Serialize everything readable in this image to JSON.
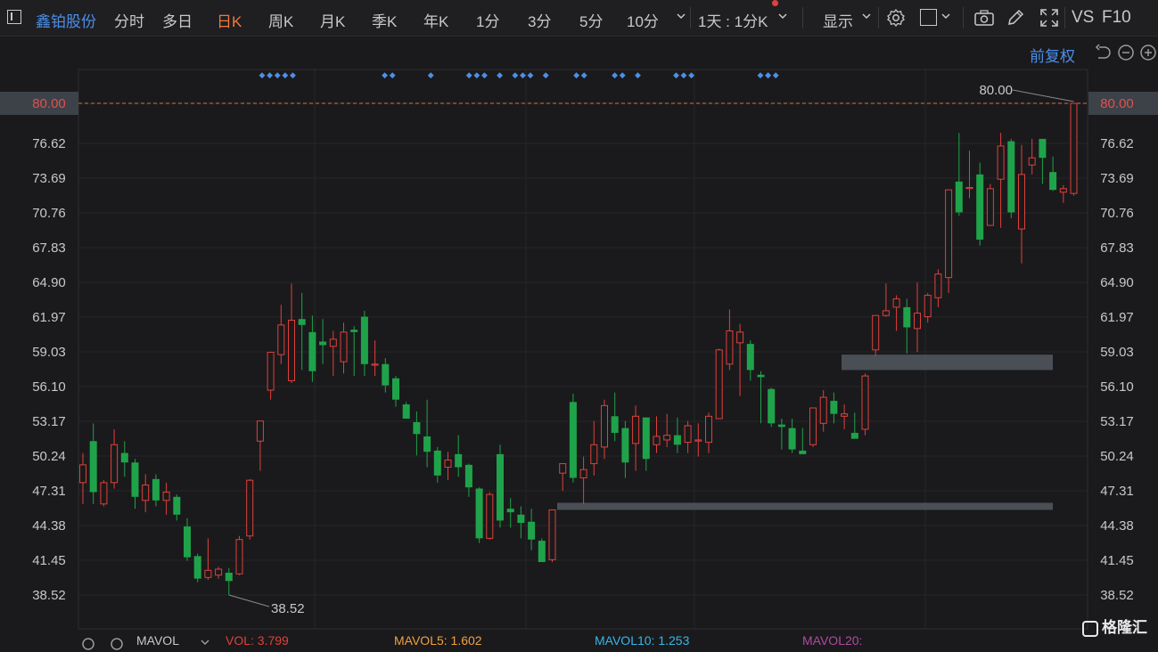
{
  "toolbar": {
    "stock_name": "鑫铂股份",
    "tabs": [
      "分时",
      "多日",
      "日K",
      "周K",
      "月K",
      "季K",
      "年K",
      "1分",
      "3分",
      "5分",
      "10分"
    ],
    "active_tab": "日K",
    "period_select": "1天 : 1分K",
    "display_label": "显示",
    "vs_label": "VS",
    "f10_label": "F10"
  },
  "subbar": {
    "adjust_label": "前复权"
  },
  "colors": {
    "up": "#e0403a",
    "down": "#1fa34a",
    "active": "#f07a3a",
    "marker": "#4c8fe8",
    "background": "#1a1a1c"
  },
  "axis": {
    "ticks": [
      "80.00",
      "76.62",
      "73.69",
      "70.76",
      "67.83",
      "64.90",
      "61.97",
      "59.03",
      "56.10",
      "53.17",
      "50.24",
      "47.31",
      "44.38",
      "41.45",
      "38.52"
    ],
    "current_price": "80.00",
    "high_label": "80.00",
    "low_label": "38.52"
  },
  "chart_data": {
    "type": "candlestick",
    "ylim": [
      37.0,
      81.5
    ],
    "last_price": 80.0,
    "period_high": 80.0,
    "period_low": 38.52,
    "candles": [
      {
        "o": 48.0,
        "h": 50.5,
        "l": 46.2,
        "c": 49.5
      },
      {
        "o": 51.5,
        "h": 53.0,
        "l": 46.2,
        "c": 47.2
      },
      {
        "o": 46.2,
        "h": 48.2,
        "l": 46.0,
        "c": 48.0
      },
      {
        "o": 48.0,
        "h": 52.5,
        "l": 47.5,
        "c": 51.2
      },
      {
        "o": 50.5,
        "h": 51.5,
        "l": 48.5,
        "c": 49.7
      },
      {
        "o": 49.7,
        "h": 50.0,
        "l": 45.8,
        "c": 46.8
      },
      {
        "o": 46.5,
        "h": 48.7,
        "l": 45.5,
        "c": 47.8
      },
      {
        "o": 48.3,
        "h": 48.7,
        "l": 46.0,
        "c": 46.5
      },
      {
        "o": 46.5,
        "h": 48.0,
        "l": 45.3,
        "c": 47.2
      },
      {
        "o": 46.8,
        "h": 47.0,
        "l": 44.8,
        "c": 45.3
      },
      {
        "o": 44.3,
        "h": 45.0,
        "l": 41.4,
        "c": 41.7
      },
      {
        "o": 41.8,
        "h": 42.0,
        "l": 39.6,
        "c": 39.9
      },
      {
        "o": 40.0,
        "h": 43.3,
        "l": 39.8,
        "c": 40.6
      },
      {
        "o": 40.2,
        "h": 40.9,
        "l": 39.9,
        "c": 40.7
      },
      {
        "o": 40.4,
        "h": 40.8,
        "l": 38.5,
        "c": 39.7
      },
      {
        "o": 40.3,
        "h": 43.5,
        "l": 40.2,
        "c": 43.2
      },
      {
        "o": 43.5,
        "h": 48.3,
        "l": 43.2,
        "c": 48.2
      },
      {
        "o": 51.5,
        "h": 53.2,
        "l": 49.0,
        "c": 53.2
      },
      {
        "o": 55.8,
        "h": 59.0,
        "l": 55.0,
        "c": 59.0
      },
      {
        "o": 58.8,
        "h": 63.0,
        "l": 58.0,
        "c": 61.3
      },
      {
        "o": 56.6,
        "h": 64.8,
        "l": 56.4,
        "c": 61.7
      },
      {
        "o": 61.8,
        "h": 64.0,
        "l": 57.5,
        "c": 61.3
      },
      {
        "o": 60.7,
        "h": 62.1,
        "l": 56.5,
        "c": 57.4
      },
      {
        "o": 59.9,
        "h": 61.8,
        "l": 58.0,
        "c": 59.6
      },
      {
        "o": 59.5,
        "h": 60.8,
        "l": 57.0,
        "c": 60.1
      },
      {
        "o": 58.2,
        "h": 61.5,
        "l": 57.2,
        "c": 60.7
      },
      {
        "o": 60.9,
        "h": 61.2,
        "l": 57.0,
        "c": 60.7
      },
      {
        "o": 62.0,
        "h": 62.5,
        "l": 57.0,
        "c": 58.0
      },
      {
        "o": 58.0,
        "h": 60.0,
        "l": 57.0,
        "c": 58.0
      },
      {
        "o": 58.0,
        "h": 58.5,
        "l": 55.6,
        "c": 56.2
      },
      {
        "o": 56.8,
        "h": 57.0,
        "l": 54.4,
        "c": 55.0
      },
      {
        "o": 54.6,
        "h": 54.8,
        "l": 53.4,
        "c": 53.4
      },
      {
        "o": 53.1,
        "h": 54.0,
        "l": 50.3,
        "c": 52.1
      },
      {
        "o": 51.9,
        "h": 55.0,
        "l": 49.3,
        "c": 50.6
      },
      {
        "o": 50.7,
        "h": 51.0,
        "l": 48.0,
        "c": 48.6
      },
      {
        "o": 49.3,
        "h": 50.6,
        "l": 48.2,
        "c": 49.9
      },
      {
        "o": 50.4,
        "h": 52.0,
        "l": 48.5,
        "c": 49.3
      },
      {
        "o": 49.5,
        "h": 49.6,
        "l": 46.8,
        "c": 47.6
      },
      {
        "o": 47.5,
        "h": 47.6,
        "l": 42.9,
        "c": 43.3
      },
      {
        "o": 43.3,
        "h": 47.2,
        "l": 43.2,
        "c": 47.0
      },
      {
        "o": 50.4,
        "h": 51.2,
        "l": 44.2,
        "c": 44.8
      },
      {
        "o": 45.8,
        "h": 46.7,
        "l": 44.2,
        "c": 45.5
      },
      {
        "o": 45.3,
        "h": 46.0,
        "l": 43.3,
        "c": 44.6
      },
      {
        "o": 44.7,
        "h": 45.8,
        "l": 42.3,
        "c": 43.2
      },
      {
        "o": 43.1,
        "h": 43.3,
        "l": 41.7,
        "c": 41.3
      },
      {
        "o": 41.5,
        "h": 45.7,
        "l": 41.3,
        "c": 45.7
      },
      {
        "o": 48.8,
        "h": 49.6,
        "l": 47.3,
        "c": 49.6
      },
      {
        "o": 54.8,
        "h": 55.5,
        "l": 48.0,
        "c": 48.4
      },
      {
        "o": 48.4,
        "h": 50.2,
        "l": 46.2,
        "c": 49.1
      },
      {
        "o": 49.6,
        "h": 53.2,
        "l": 48.6,
        "c": 51.2
      },
      {
        "o": 51.0,
        "h": 55.0,
        "l": 50.0,
        "c": 54.5
      },
      {
        "o": 53.6,
        "h": 55.6,
        "l": 51.5,
        "c": 52.2
      },
      {
        "o": 52.6,
        "h": 53.2,
        "l": 48.4,
        "c": 49.7
      },
      {
        "o": 51.3,
        "h": 54.5,
        "l": 49.0,
        "c": 53.6
      },
      {
        "o": 53.5,
        "h": 53.5,
        "l": 49.0,
        "c": 50.0
      },
      {
        "o": 51.2,
        "h": 53.6,
        "l": 50.5,
        "c": 51.9
      },
      {
        "o": 51.6,
        "h": 53.8,
        "l": 51.0,
        "c": 52.0
      },
      {
        "o": 52.0,
        "h": 53.5,
        "l": 50.5,
        "c": 51.2
      },
      {
        "o": 51.4,
        "h": 53.2,
        "l": 50.5,
        "c": 52.8
      },
      {
        "o": 51.6,
        "h": 53.0,
        "l": 50.2,
        "c": 51.6
      },
      {
        "o": 51.4,
        "h": 53.9,
        "l": 50.5,
        "c": 53.6
      },
      {
        "o": 53.4,
        "h": 59.3,
        "l": 53.4,
        "c": 59.2
      },
      {
        "o": 58.0,
        "h": 62.6,
        "l": 57.5,
        "c": 60.8
      },
      {
        "o": 59.8,
        "h": 61.4,
        "l": 55.3,
        "c": 60.7
      },
      {
        "o": 59.7,
        "h": 60.0,
        "l": 56.6,
        "c": 57.5
      },
      {
        "o": 57.1,
        "h": 57.4,
        "l": 53.0,
        "c": 56.9
      },
      {
        "o": 55.9,
        "h": 56.0,
        "l": 52.7,
        "c": 53.0
      },
      {
        "o": 52.9,
        "h": 53.4,
        "l": 50.8,
        "c": 52.7
      },
      {
        "o": 52.6,
        "h": 53.4,
        "l": 50.5,
        "c": 50.8
      },
      {
        "o": 50.7,
        "h": 52.6,
        "l": 50.5,
        "c": 50.4
      },
      {
        "o": 51.2,
        "h": 54.3,
        "l": 51.0,
        "c": 54.3
      },
      {
        "o": 53.0,
        "h": 55.8,
        "l": 52.3,
        "c": 55.2
      },
      {
        "o": 54.9,
        "h": 55.6,
        "l": 53.0,
        "c": 53.8
      },
      {
        "o": 53.6,
        "h": 54.6,
        "l": 52.5,
        "c": 53.8
      },
      {
        "o": 52.2,
        "h": 53.9,
        "l": 52.0,
        "c": 51.7
      },
      {
        "o": 52.5,
        "h": 57.2,
        "l": 52.0,
        "c": 57.0
      },
      {
        "o": 59.2,
        "h": 61.9,
        "l": 58.7,
        "c": 62.1
      },
      {
        "o": 62.1,
        "h": 64.8,
        "l": 62.0,
        "c": 62.5
      },
      {
        "o": 62.8,
        "h": 63.8,
        "l": 60.8,
        "c": 63.5
      },
      {
        "o": 62.8,
        "h": 63.5,
        "l": 58.9,
        "c": 61.1
      },
      {
        "o": 61.0,
        "h": 64.9,
        "l": 59.0,
        "c": 62.3
      },
      {
        "o": 62.0,
        "h": 64.0,
        "l": 61.5,
        "c": 63.8
      },
      {
        "o": 63.6,
        "h": 66.0,
        "l": 62.8,
        "c": 65.6
      },
      {
        "o": 65.3,
        "h": 67.0,
        "l": 64.0,
        "c": 72.7
      },
      {
        "o": 73.4,
        "h": 77.5,
        "l": 70.5,
        "c": 70.8
      },
      {
        "o": 72.9,
        "h": 76.0,
        "l": 72.0,
        "c": 72.9
      },
      {
        "o": 74.0,
        "h": 75.0,
        "l": 68.0,
        "c": 68.5
      },
      {
        "o": 69.7,
        "h": 73.2,
        "l": 69.7,
        "c": 72.8
      },
      {
        "o": 73.6,
        "h": 77.5,
        "l": 69.5,
        "c": 76.4
      },
      {
        "o": 76.8,
        "h": 77.0,
        "l": 70.3,
        "c": 70.8
      },
      {
        "o": 69.4,
        "h": 76.5,
        "l": 66.5,
        "c": 74.0
      },
      {
        "o": 74.8,
        "h": 77.0,
        "l": 74.0,
        "c": 75.4
      },
      {
        "o": 77.0,
        "h": 77.0,
        "l": 73.2,
        "c": 75.4
      },
      {
        "o": 74.2,
        "h": 75.5,
        "l": 72.6,
        "c": 72.7
      },
      {
        "o": 72.5,
        "h": 73.1,
        "l": 71.6,
        "c": 72.8
      },
      {
        "o": 72.4,
        "h": 80.0,
        "l": 72.2,
        "c": 80.0
      }
    ],
    "zones": [
      {
        "from_candle": 71,
        "to_candle": 95,
        "low": 57.5,
        "high": 58.8
      },
      {
        "from_candle": 45,
        "to_candle": 95,
        "low": 45.7,
        "high": 46.3
      }
    ]
  },
  "markers": {
    "symbol": "◆",
    "at_candles": [
      16,
      17,
      18,
      19,
      20,
      32,
      33,
      38,
      43,
      44,
      45,
      47,
      49,
      50,
      51,
      53,
      57,
      58,
      62,
      63,
      65,
      70,
      71,
      72,
      81,
      82,
      82,
      83
    ]
  },
  "bottom": {
    "mavol_label": "MAVOL",
    "vol_label": "VOL: 3.799",
    "mavol5_label": "MAVOL5: 1.602",
    "mavol10_label": "MAVOL10: 1.253",
    "mavol20_label": "MAVOL20:",
    "colors": {
      "vol": "#e0403a",
      "mavol5": "#f0a040",
      "mavol10": "#38b6e8",
      "mavol20": "#b24aa0"
    }
  },
  "brand": {
    "logo_text": "格隆汇"
  }
}
